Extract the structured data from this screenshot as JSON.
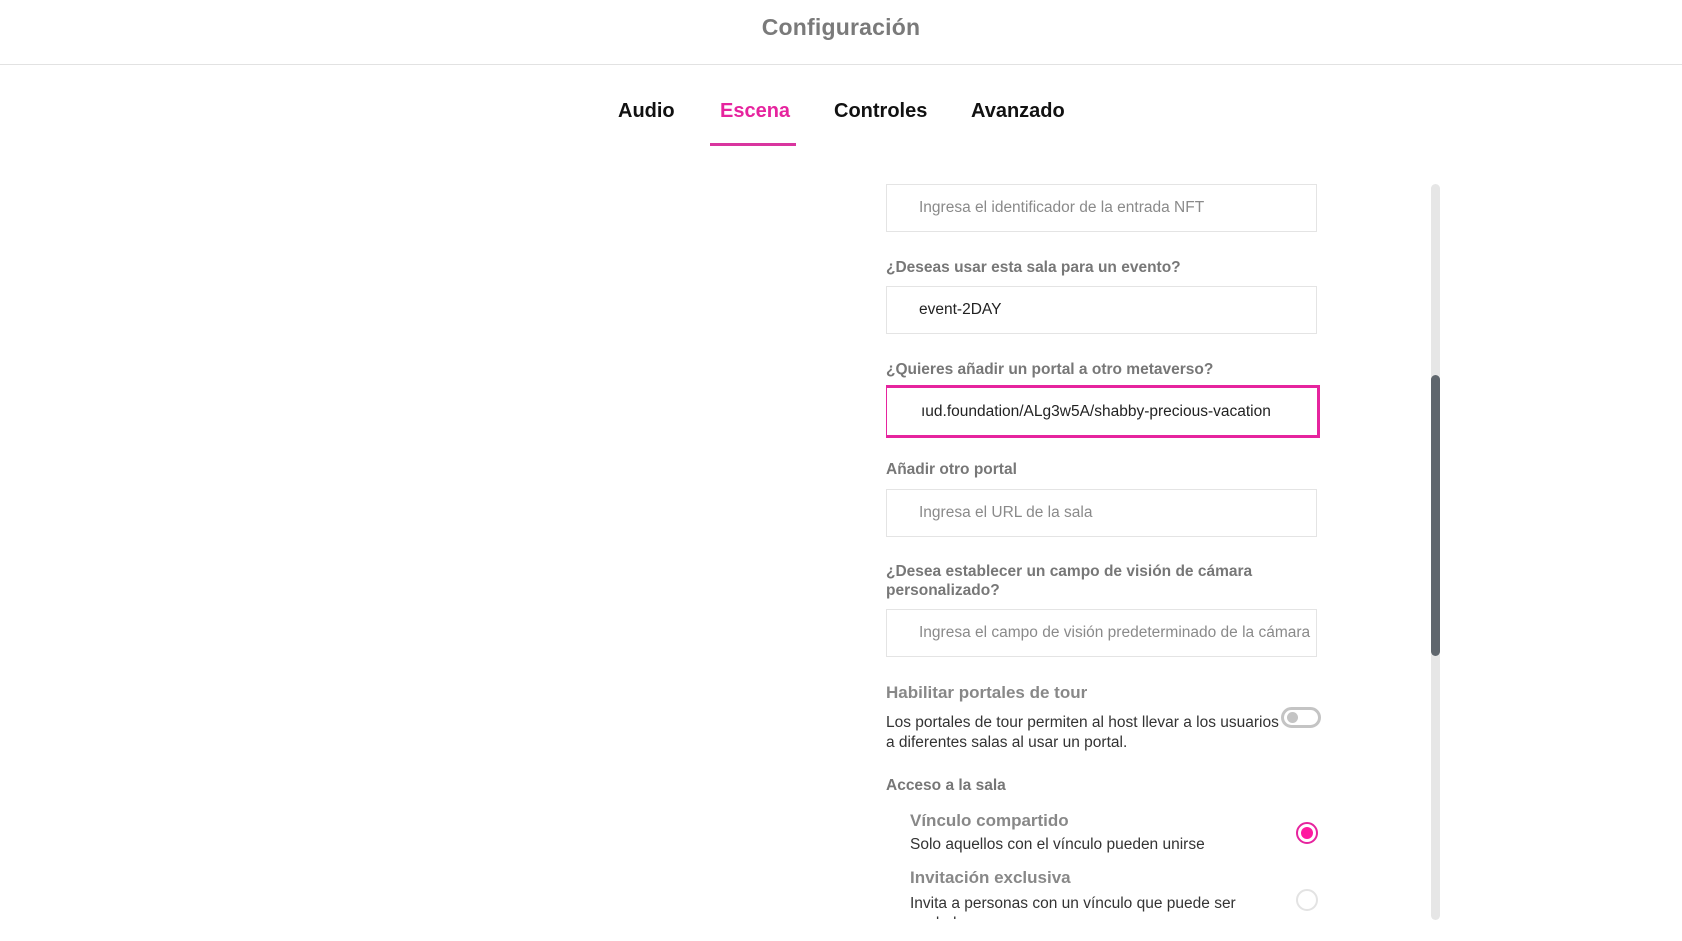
{
  "header": {
    "title": "Configuración"
  },
  "tabs": [
    {
      "label": "Audio",
      "active": false
    },
    {
      "label": "Escena",
      "active": true
    },
    {
      "label": "Controles",
      "active": false
    },
    {
      "label": "Avanzado",
      "active": false
    }
  ],
  "colors": {
    "accent": "#e6249e",
    "scrollbar_thumb": "#5f666d",
    "toggle_off": "#c4c4c4"
  },
  "form": {
    "nft_input": {
      "value": "",
      "placeholder": "Ingresa el identificador de la entrada NFT"
    },
    "event": {
      "label": "¿Deseas usar esta sala para un evento?",
      "value": "event-2DAY",
      "placeholder": ""
    },
    "portal": {
      "label": "¿Quieres añadir un portal a otro metaverso?",
      "value": "ıud.foundation/ALg3w5A/shabby-precious-vacation",
      "focused": true
    },
    "another_portal": {
      "label": "Añadir otro portal",
      "value": "",
      "placeholder": "Ingresa el URL de la sala"
    },
    "fov": {
      "label": "¿Desea establecer un campo de visión de cámara personalizado?",
      "value": "",
      "placeholder": "Ingresa el campo de visión predeterminado de la cámara"
    },
    "tour_portals": {
      "title": "Habilitar portales de tour",
      "description": "Los portales de tour permiten al host llevar a los usuarios a diferentes salas al usar un portal.",
      "enabled": false
    },
    "room_access": {
      "label": "Acceso a la sala",
      "options": [
        {
          "title": "Vínculo compartido",
          "description": "Solo aquellos con el vínculo pueden unirse",
          "selected": true
        },
        {
          "title": "Invitación exclusiva",
          "description": "Invita a personas con un vínculo que puede ser anulado",
          "selected": false
        }
      ]
    }
  },
  "scrollbar": {
    "position_fraction": 0.26,
    "visible_fraction": 0.38
  }
}
